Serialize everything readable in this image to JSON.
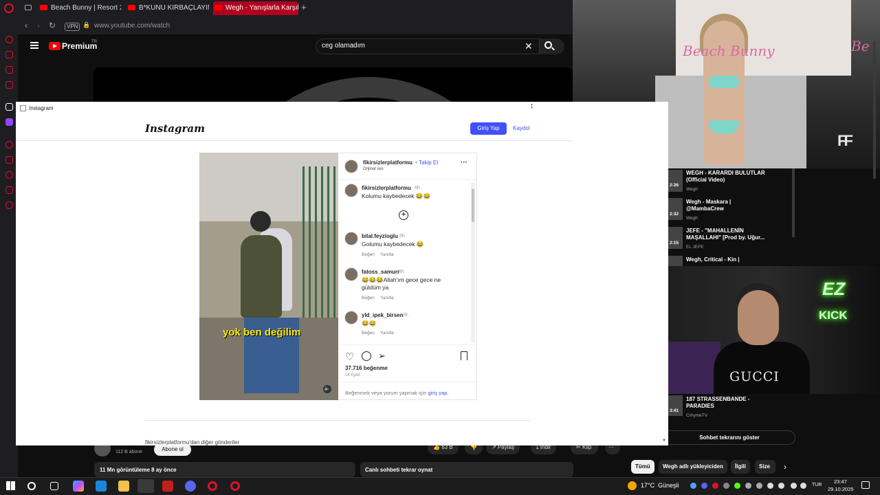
{
  "browser": {
    "tabs": [
      {
        "title": "Beach Bunny | Resort 20"
      },
      {
        "title": "B*KUNU KIRBAÇLAYIM | "
      },
      {
        "title": "Wegh - Yanışlarla Karşıla"
      }
    ],
    "new_tab_symbol": "+",
    "vpn_label": "VPN",
    "url": "www.youtube.com/watch"
  },
  "youtube": {
    "brand": "Premium",
    "region": "TR",
    "search_query": "ceg olamadım",
    "channel_subscribers": "112 B abone",
    "subscribe_label": "Abone ol",
    "likes_label": "63 B",
    "share_label": "Paylaş",
    "download_label": "İndir",
    "clip_label": "Klip",
    "views_line": "11 Mn görüntüleme  8 ay önce",
    "chat_replay_label": "Canlı sohbeti tekrar oynat",
    "show_chat_label": "Sohbet tekrarını göster",
    "chips": [
      "Tümü",
      "Wegh adlı yükleyiciden",
      "İlgili",
      "Size ö"
    ],
    "recommendations": [
      {
        "title": "WEGH - KARARDI BULUTLAR (Official Video)",
        "channel": "Wegh",
        "duration": "2:26"
      },
      {
        "title": "Wegh - Maskara | @MambaCrew",
        "channel": "Wegh",
        "duration": "2:32"
      },
      {
        "title": "JEFE - \"MAHALLENİN MAŞALLAHI\" [Prod by. Uğur...",
        "channel": "EL JEFE",
        "duration": "2:15"
      },
      {
        "title": "Wegh, Critical - Kin |",
        "channel": "",
        "duration": ""
      },
      {
        "title": "187 STRASSENBANDE - PARADIES",
        "channel": "CrhymeTV",
        "duration": "3:41"
      }
    ]
  },
  "runway_overlay": {
    "brand_text": "Beach Bunny",
    "brand_text_right": "Be",
    "watermark": "FF"
  },
  "webcam": {
    "shirt_text": "GUCCI",
    "neon_top": "EZ",
    "neon_bottom": "KICK"
  },
  "instagram_popup": {
    "window_title": "Instagram",
    "logo_text": "Instagram",
    "login_button": "Giriş Yap",
    "signup_link": "Kaydol",
    "post": {
      "username": "fikirsizlerplatformu",
      "follow_label": "Takip Et",
      "audio_label": "Orijinal ses",
      "caption_overlay": "yok ben değilim",
      "comments": [
        {
          "user": "fikirsizlerplatformu",
          "time": "6h",
          "text": "Kolumu kaybedecek 😂😂",
          "reply": "",
          "like": ""
        },
        {
          "user": "bilal.feyzioglu",
          "time": "5h",
          "text": "Golumu kaybedecek 😂",
          "like": "Beğen",
          "reply": "Yanıtla"
        },
        {
          "user": "fatoss_samurr",
          "time": "3h",
          "text": "😂😂😂Allah'ım gece gece ne güldüm ya",
          "like": "Beğen",
          "reply": "Yanıtla"
        },
        {
          "user": "yld_ipek_birsen",
          "time": "3h",
          "text": "😂😂",
          "like": "Beğen",
          "reply": "Yanıtla"
        }
      ],
      "likes": "37.716 beğenme",
      "date": "14 Eylül",
      "login_prompt": "Beğenmek veya yorum yapmak için ",
      "login_prompt_link": "giriş yap."
    },
    "more_posts": "fikirsizlerplatformu'dan diğer gönderiler"
  },
  "taskbar": {
    "weather_temp": "17°C",
    "weather_desc": "Güneşli",
    "language": "TUR",
    "time": "23:47",
    "date": "29.10.2025"
  },
  "colors": {
    "opera_red": "#e0102c",
    "instagram_blue": "#4150f7",
    "youtube_red": "#ff0000",
    "kick_green": "#53fc18"
  }
}
